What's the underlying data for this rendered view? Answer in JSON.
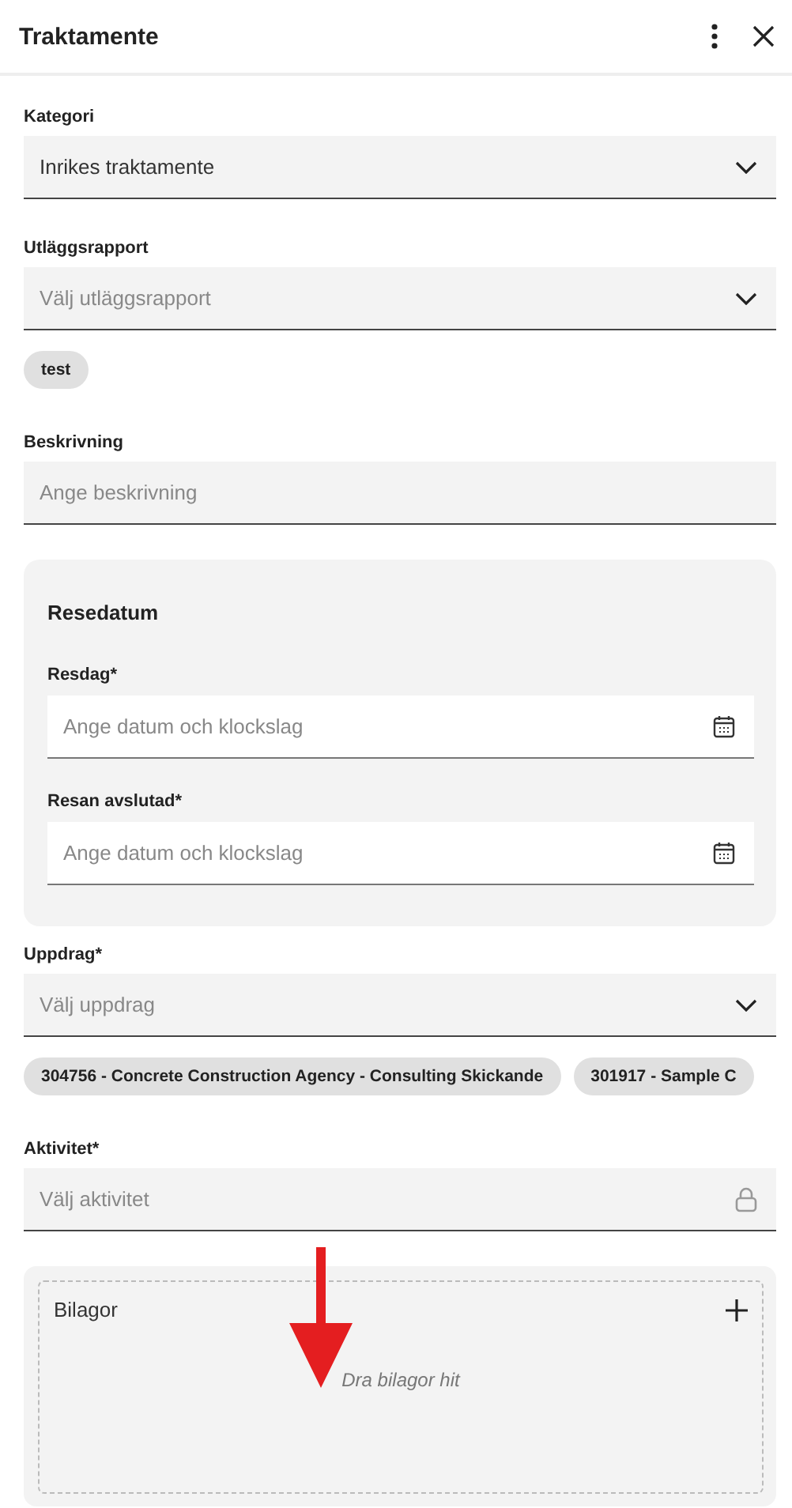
{
  "title": "Traktamente",
  "items": [
    {
      "kind": "select",
      "label": "Kategori",
      "value": "Inrikes traktamente"
    },
    {
      "kind": "select",
      "label": "Utläggsrapport",
      "placeholder": "Välj utläggsrapport",
      "chips": [
        "test"
      ]
    },
    {
      "kind": "text",
      "label": "Beskrivning",
      "placeholder": "Ange beskrivning"
    },
    {
      "kind": "group",
      "title": "Resedatum",
      "fields": [
        {
          "kind": "date",
          "label": "Resdag*",
          "placeholder": "Ange datum och klockslag"
        },
        {
          "kind": "date",
          "label": "Resan avslutad*",
          "placeholder": "Ange datum och klockslag"
        }
      ]
    },
    {
      "kind": "select",
      "label": "Uppdrag*",
      "placeholder": "Välj uppdrag",
      "chips": [
        "304756 - Concrete Construction Agency - Consulting Skickande",
        "301917 - Sample C"
      ]
    },
    {
      "kind": "locked",
      "label": "Aktivitet*",
      "placeholder": "Välj aktivitet"
    },
    {
      "kind": "attachments",
      "label": "Bilagor",
      "hint": "Dra bilagor hit"
    }
  ]
}
